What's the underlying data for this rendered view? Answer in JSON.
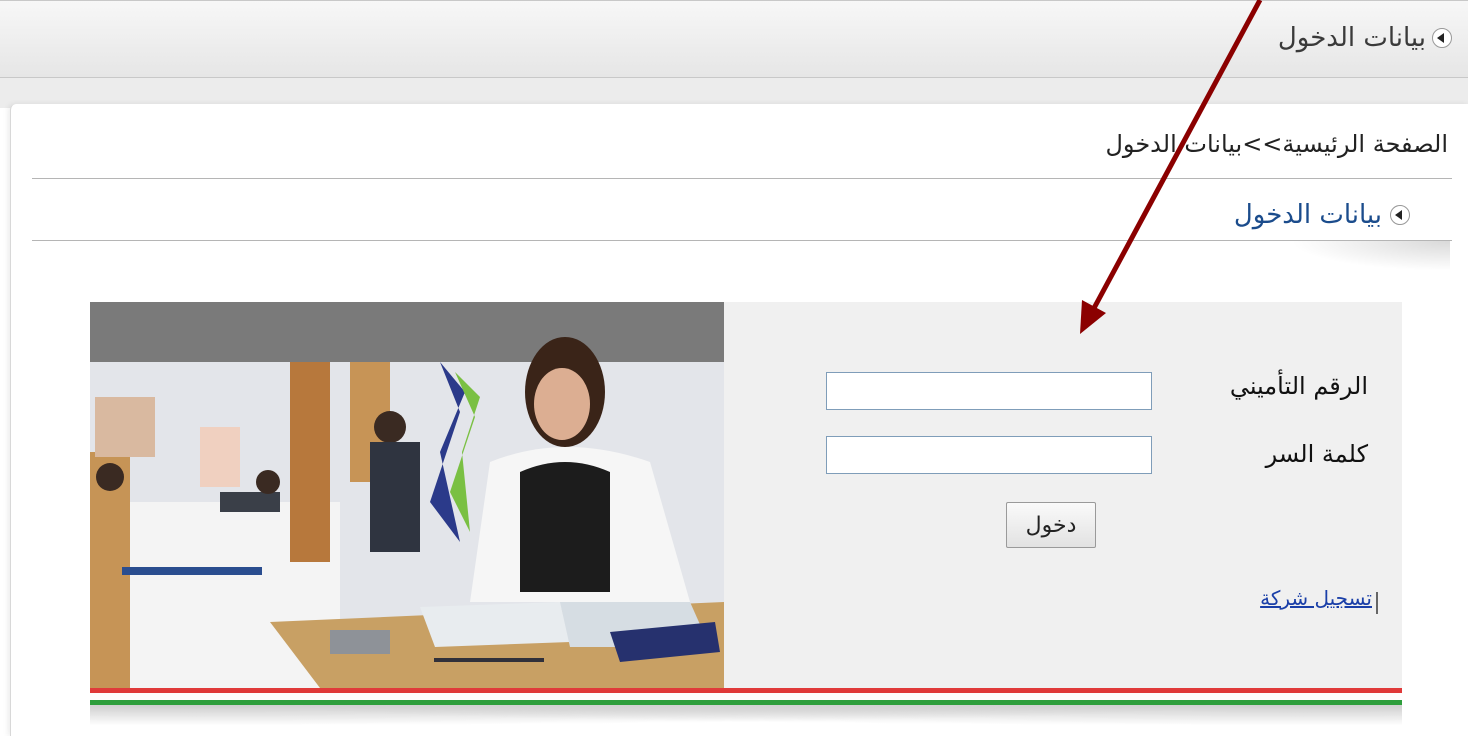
{
  "header": {
    "title": "بيانات الدخول"
  },
  "breadcrumb": {
    "home": "الصفحة الرئيسية",
    "separator": ">>",
    "current": "بيانات الدخول"
  },
  "section": {
    "title": "بيانات الدخول"
  },
  "form": {
    "insurance_number_label": "الرقم التأميني",
    "insurance_number_value": "",
    "password_label": "كلمة السر",
    "password_value": "",
    "login_button": "دخول",
    "register_link": "تسجيل شركة"
  },
  "colors": {
    "accent_blue": "#1b4c8c",
    "link": "#1a3fa8",
    "stripe_red": "#e03a3a",
    "stripe_green": "#2e9e3c",
    "annotation_arrow": "#8b0000"
  },
  "icons": {
    "section_marker": "left-arrow-circle-icon"
  }
}
